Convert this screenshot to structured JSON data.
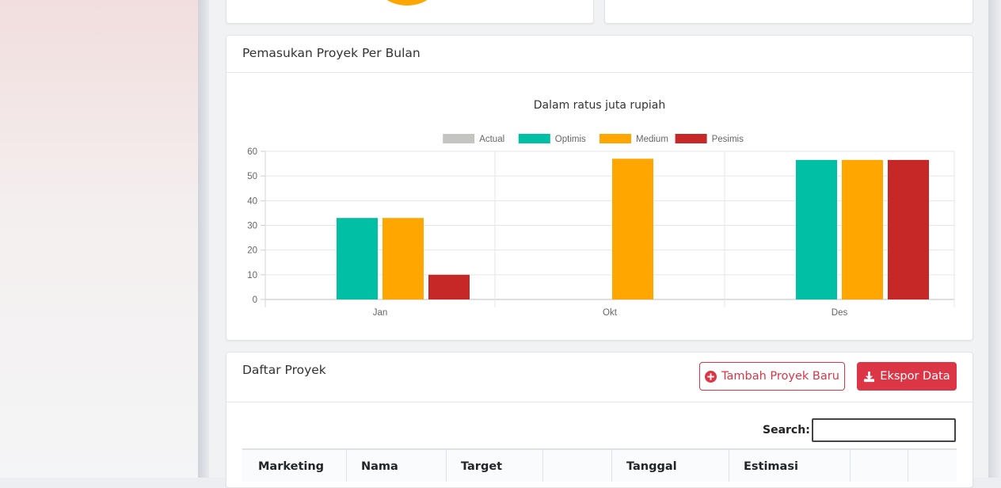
{
  "income_card": {
    "title": "Pemasukan Proyek Per Bulan"
  },
  "chart_data": {
    "type": "bar",
    "title": "Dalam ratus juta rupiah",
    "categories": [
      "Jan",
      "Okt",
      "Des"
    ],
    "series": [
      {
        "name": "Actual",
        "color": "#c4c4c0",
        "values": [
          0,
          0,
          0
        ]
      },
      {
        "name": "Optimis",
        "color": "#00bfa5",
        "values": [
          33,
          0,
          56.5
        ]
      },
      {
        "name": "Medium",
        "color": "#ffa600",
        "values": [
          33,
          57,
          56.5
        ]
      },
      {
        "name": "Pesimis",
        "color": "#c62828",
        "values": [
          10,
          0,
          56.5
        ]
      }
    ],
    "ylim": [
      0,
      60
    ],
    "yticks": [
      0,
      10,
      20,
      30,
      40,
      50,
      60
    ],
    "legend_position": "top",
    "grid": true
  },
  "projects_card": {
    "title": "Daftar Proyek",
    "add_button_label": "Tambah Proyek Baru",
    "export_button_label": "Ekspor Data",
    "search_label": "Search:",
    "search_value": "",
    "columns": [
      "Marketing",
      "Nama",
      "Target",
      "",
      "Tanggal",
      "Estimasi",
      "",
      ""
    ]
  },
  "colors": {
    "accent": "#dc3545"
  }
}
